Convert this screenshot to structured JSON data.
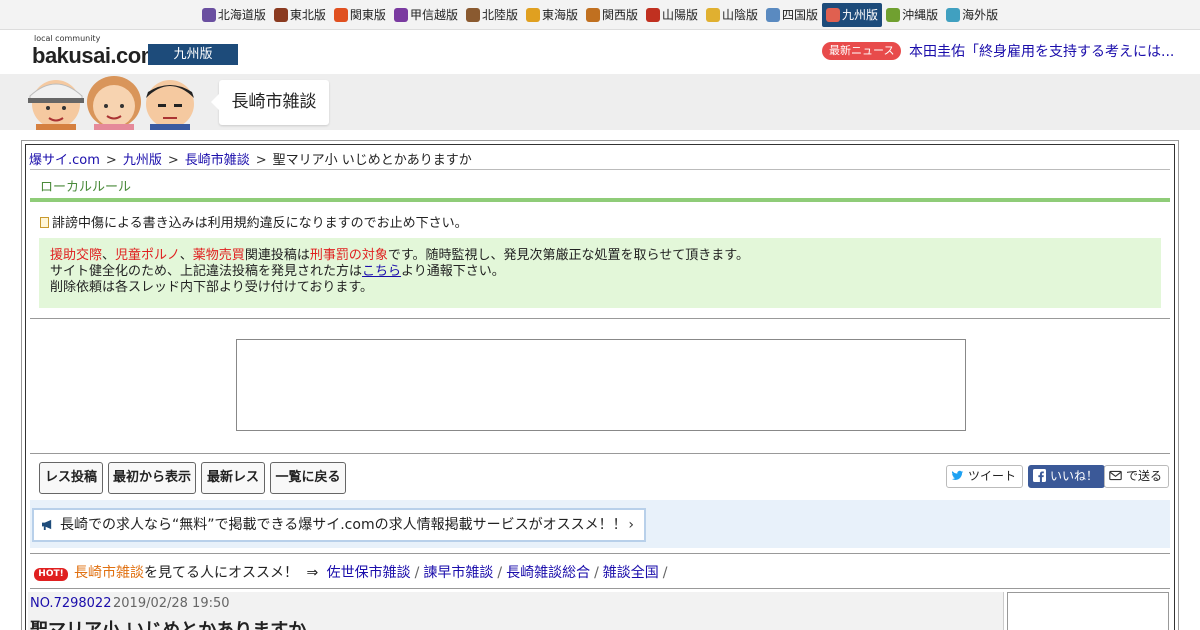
{
  "regions": [
    {
      "label": "北海道版",
      "icon": "hokkaido-icon",
      "color": "#6a4fa0",
      "active": false
    },
    {
      "label": "東北版",
      "icon": "tohoku-icon",
      "color": "#8a3a20",
      "active": false
    },
    {
      "label": "関東版",
      "icon": "tower-icon",
      "color": "#e05020",
      "active": false
    },
    {
      "label": "甲信越版",
      "icon": "grape-icon",
      "color": "#7a3aa0",
      "active": false
    },
    {
      "label": "北陸版",
      "icon": "gate-icon",
      "color": "#8a5a30",
      "active": false
    },
    {
      "label": "東海版",
      "icon": "shachihoko-icon",
      "color": "#e0a020",
      "active": false
    },
    {
      "label": "関西版",
      "icon": "takoyaki-icon",
      "color": "#c07020",
      "active": false
    },
    {
      "label": "山陽版",
      "icon": "castle-icon",
      "color": "#c03020",
      "active": false
    },
    {
      "label": "山陰版",
      "icon": "crab-icon",
      "color": "#e0b030",
      "active": false
    },
    {
      "label": "四国版",
      "icon": "udon-icon",
      "color": "#5a8ac0",
      "active": false
    },
    {
      "label": "九州版",
      "icon": "ramen-icon",
      "color": "#e06050",
      "active": true
    },
    {
      "label": "沖縄版",
      "icon": "shisa-icon",
      "color": "#70a030",
      "active": false
    },
    {
      "label": "海外版",
      "icon": "globe-icon",
      "color": "#40a0c0",
      "active": false
    }
  ],
  "header": {
    "logo_small": "local community",
    "logo": "bakusai.com",
    "edition": "九州版",
    "news_badge": "最新ニュース",
    "news_text": "本田圭佑「終身雇用を支持する考えには..."
  },
  "banner": {
    "board_title": "長崎市雑談"
  },
  "breadcrumb": {
    "items": [
      "爆サイ.com",
      "九州版",
      "長崎市雑談"
    ],
    "current": "聖マリア小 いじめとかありますか",
    "separator": ">"
  },
  "local_rule": {
    "title": "ローカルルール",
    "notice": "誹謗中傷による書き込みは利用規約違反になりますのでお止め下さい。"
  },
  "warning": {
    "w1": "援助交際",
    "comma": "、",
    "w2": "児童ポルノ",
    "w3": "薬物売買",
    "t1": "関連投稿は",
    "w4": "刑事罰の対象",
    "t2": "です。随時監視し、発見次第厳正な処置を取らせて頂きます。",
    "line2a": "サイト健全化のため、上記違法投稿を発見された方は",
    "line2_link": "こちら",
    "line2b": "より通報下さい。",
    "line3": "削除依頼は各スレッド内下部より受け付けております。"
  },
  "actions": {
    "post": "レス投稿",
    "from_start": "最初から表示",
    "latest": "最新レス",
    "back": "一覧に戻る"
  },
  "share": {
    "tweet": "ツイート",
    "like": "いいね！",
    "send": "で送る"
  },
  "promo": {
    "text": "長崎での求人なら“無料”で掲載できる爆サイ.comの求人情報掲載サービスがオススメ！！",
    "chevron": "›"
  },
  "recommend": {
    "hot": "HOT!",
    "board": "長崎市雑談",
    "suffix": "を見てる人にオススメ！",
    "arrow": "⇒",
    "links": [
      "佐世保市雑談",
      "諫早市雑談",
      "長崎雑談総合",
      "雑談全国"
    ],
    "slash": "/"
  },
  "post": {
    "number": "NO.7298022",
    "date": "2019/02/28 19:50",
    "title": "聖マリア小 いじめとかありますか"
  }
}
